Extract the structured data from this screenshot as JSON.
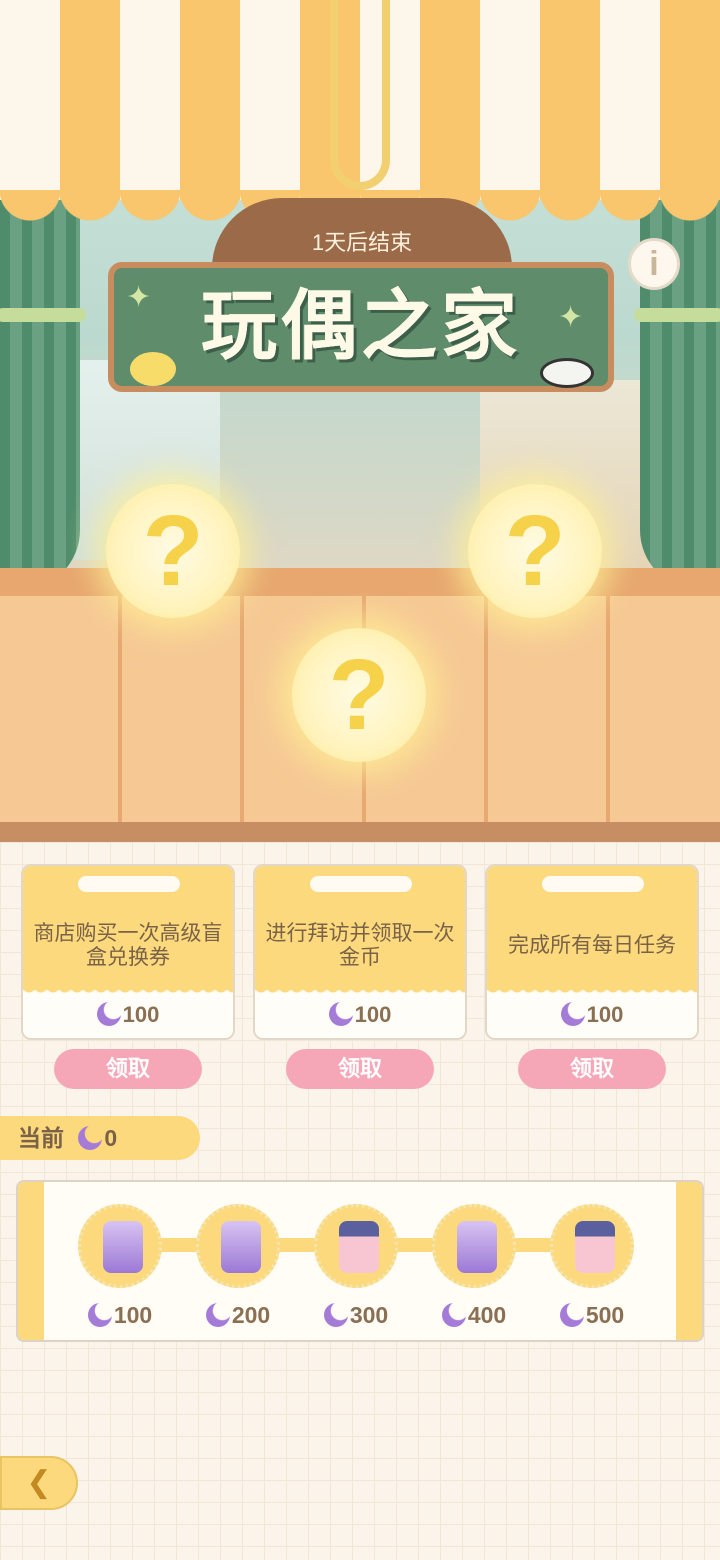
{
  "event": {
    "end_text": "1天后结束",
    "title": "玩偶之家"
  },
  "info_button": {
    "icon": "info-icon",
    "label": "i"
  },
  "mystery_slots": [
    "?",
    "?",
    "?"
  ],
  "tasks": [
    {
      "text": "商店购买一次高级盲盒兑换券",
      "reward": "100",
      "claim_label": "领取"
    },
    {
      "text": "进行拜访并领取一次金币",
      "reward": "100",
      "claim_label": "领取"
    },
    {
      "text": "完成所有每日任务",
      "reward": "100",
      "claim_label": "领取"
    }
  ],
  "current": {
    "label": "当前",
    "value": "0"
  },
  "milestones": [
    {
      "value": "100",
      "icon": "hourglass-icon"
    },
    {
      "value": "200",
      "icon": "hourglass-icon"
    },
    {
      "value": "300",
      "icon": "ticket-icon"
    },
    {
      "value": "400",
      "icon": "hourglass-icon"
    },
    {
      "value": "500",
      "icon": "ticket-icon"
    }
  ],
  "colors": {
    "accent": "#fcd97d",
    "claim": "#f6a7b7",
    "sign": "#5f8c6a",
    "moon": "#a57bd8"
  }
}
